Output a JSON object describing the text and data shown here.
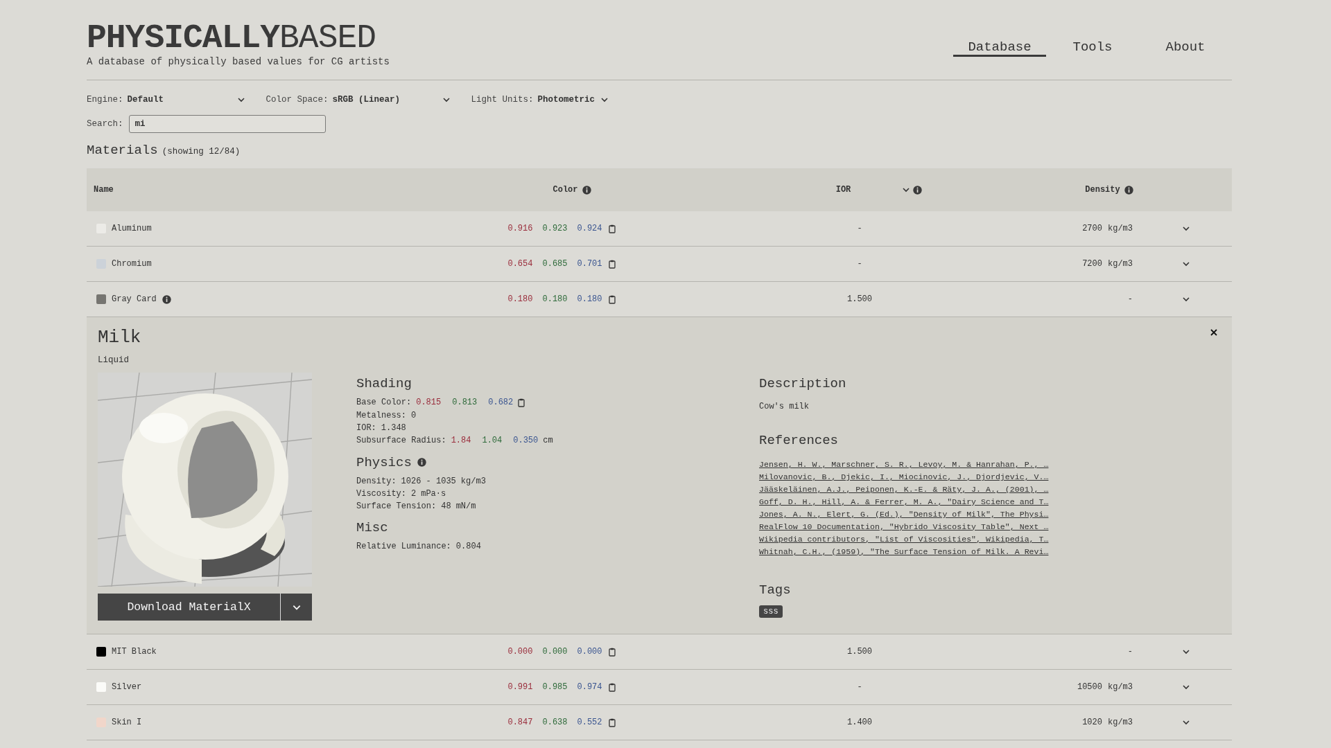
{
  "site": {
    "logo": "**PHYSICALLY**BASED",
    "tagline": "A database of physically based values for CG artists"
  },
  "nav": [
    {
      "label": "Database",
      "selected": true
    },
    {
      "label": "Tools",
      "selected": false
    },
    {
      "label": "About",
      "selected": false
    }
  ],
  "filters": [
    {
      "label": "Engine:",
      "value": "Default",
      "kind": "wide"
    },
    {
      "label": "Color Space:",
      "value": "sRGB (Linear)",
      "kind": "wide"
    },
    {
      "label": "Light Units:",
      "value": "Photometric",
      "kind": "fit"
    }
  ],
  "search": {
    "label": "Search:",
    "value": "mi"
  },
  "section": {
    "title": "Materials",
    "count": "(showing 12/84)"
  },
  "table": {
    "columns": [
      {
        "label": "Name",
        "info": false,
        "sort": false
      },
      {
        "label": "Color",
        "info": true,
        "sort": false
      },
      {
        "label": "IOR",
        "info": true,
        "sort": true
      },
      {
        "label": "Density",
        "info": true,
        "sort": false
      }
    ],
    "rows": [
      {
        "kind": "material",
        "name": "Aluminum",
        "color": "#ecebe7",
        "info": false,
        "rgb": [
          "0.916",
          "0.923",
          "0.924"
        ],
        "ior": "-",
        "density": "2700",
        "density_unit": "kg/m3"
      },
      {
        "kind": "material",
        "name": "Chromium",
        "color": "#ccd2d9",
        "info": false,
        "rgb": [
          "0.654",
          "0.685",
          "0.701"
        ],
        "ior": "-",
        "density": "7200",
        "density_unit": "kg/m3"
      },
      {
        "kind": "material",
        "name": "Gray Card",
        "color": "#767571",
        "info": true,
        "rgb": [
          "0.180",
          "0.180",
          "0.180"
        ],
        "ior": "1.500",
        "density": "-"
      },
      {
        "kind": "detail",
        "name": "Milk",
        "category": "Liquid",
        "download": "Download MaterialX",
        "groups": [
          {
            "title": "Shading",
            "info": false,
            "lines": [
              {
                "label": "Base Color:",
                "values": [
                  "0.815",
                  "0.813",
                  "0.682"
                ],
                "copy": true
              },
              {
                "label": "Metalness:",
                "values": [
                  "0"
                ],
                "copy": false
              },
              {
                "label": "IOR:",
                "values": [
                  "1.348"
                ],
                "copy": false
              },
              {
                "label": "Subsurface Radius:",
                "values": [
                  "1.84",
                  "1.04",
                  "0.350"
                ],
                "unit": "cm",
                "copy": false
              }
            ]
          },
          {
            "title": "Physics",
            "info": true,
            "lines": [
              {
                "label": "Density:",
                "values": [
                  "1026 - 1035"
                ],
                "unit": "kg/m3",
                "copy": false
              },
              {
                "label": "Viscosity:",
                "values": [
                  "2"
                ],
                "unit": "mPa·s",
                "copy": false
              },
              {
                "label": "Surface Tension:",
                "values": [
                  "48"
                ],
                "unit": "mN/m",
                "copy": false
              }
            ]
          },
          {
            "title": "Misc",
            "info": false,
            "lines": [
              {
                "label": "Relative Luminance:",
                "values": [
                  "0.804"
                ],
                "copy": false
              }
            ]
          }
        ],
        "description_title": "Description",
        "description": "Cow's milk",
        "references_title": "References",
        "references": [
          "Jensen, H. W., Marschner, S. R., Levoy, M. & Hanrahan, P., …",
          "Milovanovic, B., Djekic, I., Miocinovic, J., Djordjevic, V.…",
          "Jääskeläinen, A.J., Peiponen, K.-E. & Räty, J. A., (2001), …",
          "Goff, D. H., Hill, A. & Ferrer, M. A., \"Dairy Science and T…",
          "Jones, A. N., Elert, G. (Ed.), \"Density of Milk\", The Physi…",
          "RealFlow 10 Documentation, \"Hybrido Viscosity Table\", Next …",
          "Wikipedia contributors, \"List of Viscosities\", Wikipedia, T…",
          "Whitnah, C.H., (1959), \"The Surface Tension of Milk. A Revi…"
        ],
        "tags_title": "Tags",
        "tags": [
          "sss"
        ]
      },
      {
        "kind": "material",
        "name": "MIT Black",
        "color": "#000000",
        "info": false,
        "rgb": [
          "0.000",
          "0.000",
          "0.000"
        ],
        "ior": "1.500",
        "density": "-"
      },
      {
        "kind": "material",
        "name": "Silver",
        "color": "#fbfbf8",
        "info": false,
        "rgb": [
          "0.991",
          "0.985",
          "0.974"
        ],
        "ior": "-",
        "density": "10500",
        "density_unit": "kg/m3"
      },
      {
        "kind": "material",
        "name": "Skin I",
        "color": "#f1d6ca",
        "info": false,
        "rgb": [
          "0.847",
          "0.638",
          "0.552"
        ],
        "ior": "1.400",
        "density": "1020",
        "density_unit": "kg/m3"
      }
    ]
  }
}
